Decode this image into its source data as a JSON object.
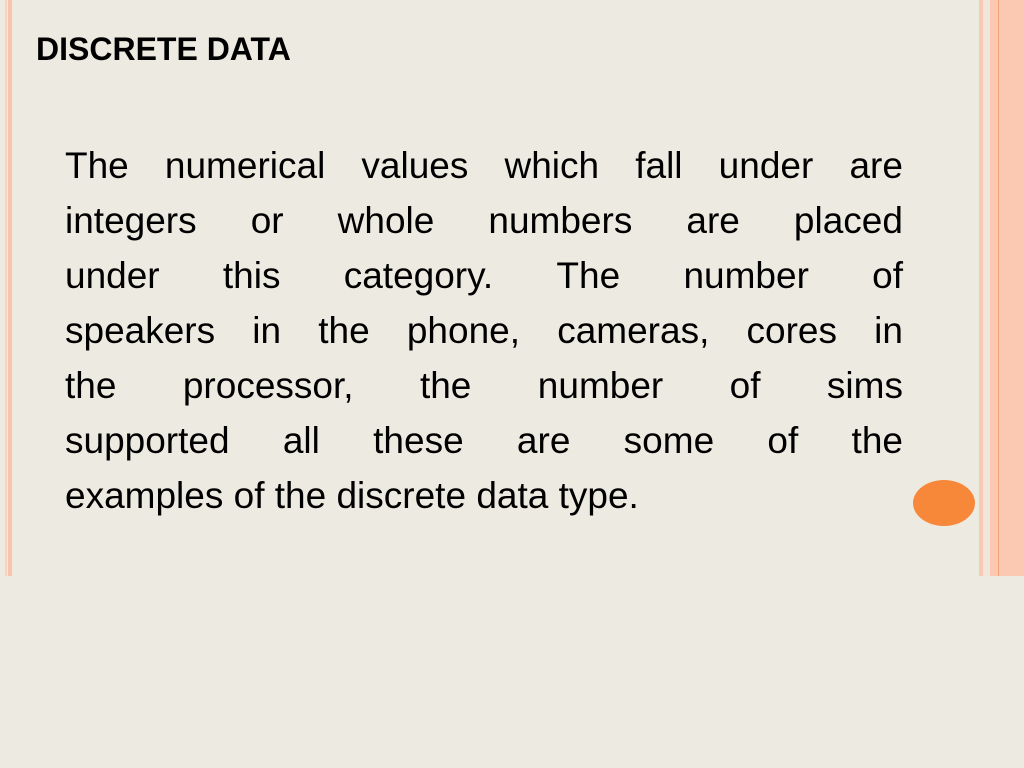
{
  "slide": {
    "title": "DISCRETE DATA",
    "body_lines": [
      "The numerical values which fall under are",
      "integers or whole numbers are placed",
      "under this category. The number of",
      "speakers in the phone, cameras, cores in",
      "the processor, the number of sims",
      "supported all these are some of the",
      "examples of the discrete data type."
    ],
    "body_full": "The numerical values which fall under are integers or whole numbers are placed under this category. The number of speakers in the phone, cameras, cores in the processor, the number of sims supported all these are some of the examples of the discrete data type."
  },
  "theme": {
    "background": "#EDEAE1",
    "stripe_color": "#FBC8B1",
    "accent_dot_color": "#F7883A",
    "text_color": "#000000"
  }
}
